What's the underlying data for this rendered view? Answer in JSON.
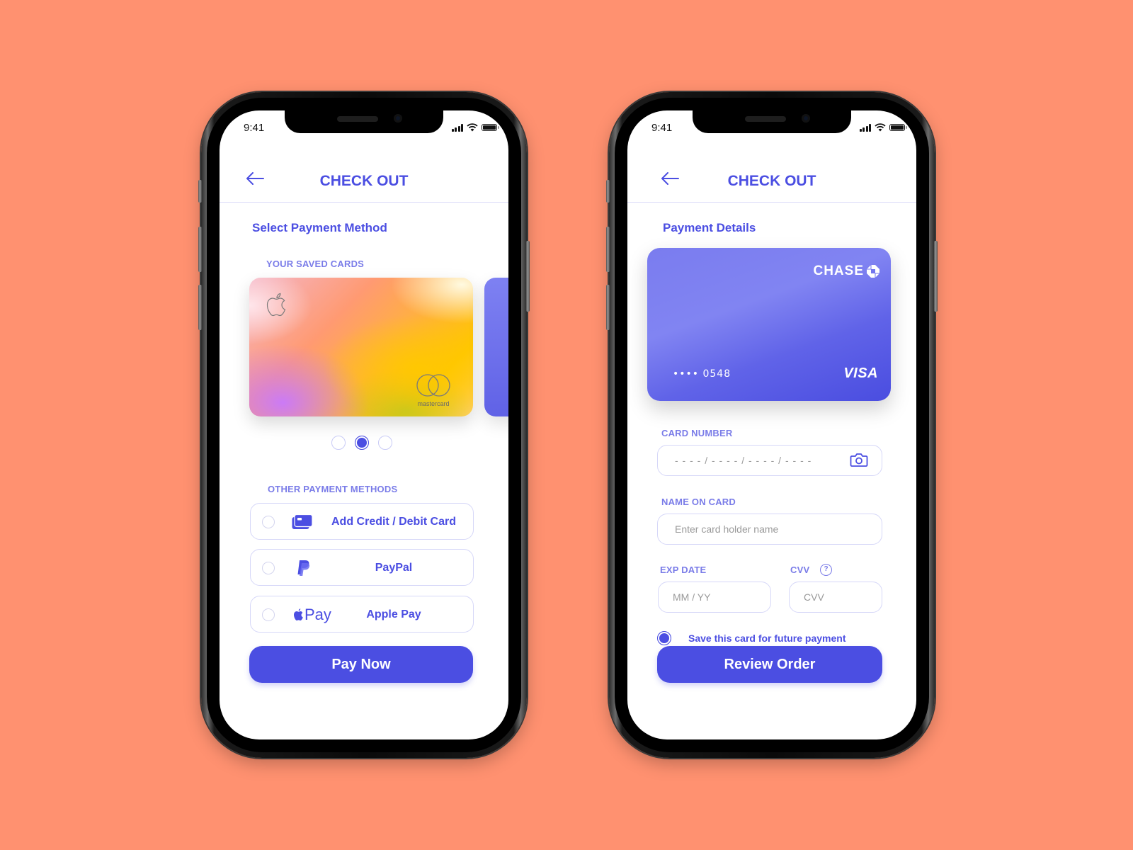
{
  "colors": {
    "background": "#ff9170",
    "accent": "#4b4ee2",
    "label": "#7a7ce8",
    "border": "#d6d7f8"
  },
  "status_bar": {
    "time": "9:41",
    "icons": [
      "signal-icon",
      "wifi-icon",
      "battery-icon"
    ]
  },
  "screen1": {
    "header": {
      "back_icon": "arrow-left-icon",
      "title": "CHECK OUT"
    },
    "section_title": "Select Payment Method",
    "saved_cards_label": "YOUR SAVED CARDS",
    "saved_cards": [
      {
        "type": "Apple Card",
        "brand_icon": "apple-logo-icon",
        "network": "mastercard"
      },
      {
        "type": "Chase Visa",
        "partially_visible": true
      }
    ],
    "carousel": {
      "count": 3,
      "active_index": 1
    },
    "other_methods_label": "OTHER PAYMENT METHODS",
    "methods": [
      {
        "label": "Add Credit / Debit Card",
        "icon": "credit-card-icon",
        "selected": false
      },
      {
        "label": "PayPal",
        "icon": "paypal-icon",
        "selected": false
      },
      {
        "label": "Apple Pay",
        "icon": "apple-pay-icon",
        "icon_text": "Pay",
        "selected": false
      }
    ],
    "primary_button": "Pay Now"
  },
  "screen2": {
    "header": {
      "back_icon": "arrow-left-icon",
      "title": "CHECK OUT"
    },
    "section_title": "Payment Details",
    "card": {
      "bank": "CHASE",
      "number_masked": "•••• 0548",
      "network": "VISA"
    },
    "fields": {
      "card_number": {
        "label": "CARD NUMBER",
        "placeholder": "- - - - / - - - - / - - - - / - - - -",
        "value": ""
      },
      "name_on_card": {
        "label": "NAME ON CARD",
        "placeholder": "Enter card holder name",
        "value": ""
      },
      "exp_date": {
        "label": "EXP DATE",
        "placeholder": "MM / YY",
        "value": ""
      },
      "cvv": {
        "label": "CVV",
        "placeholder": "CVV",
        "value": "",
        "help": "?"
      }
    },
    "save_card": {
      "label": "Save this card for future payment",
      "checked": true
    },
    "primary_button": "Review Order"
  }
}
